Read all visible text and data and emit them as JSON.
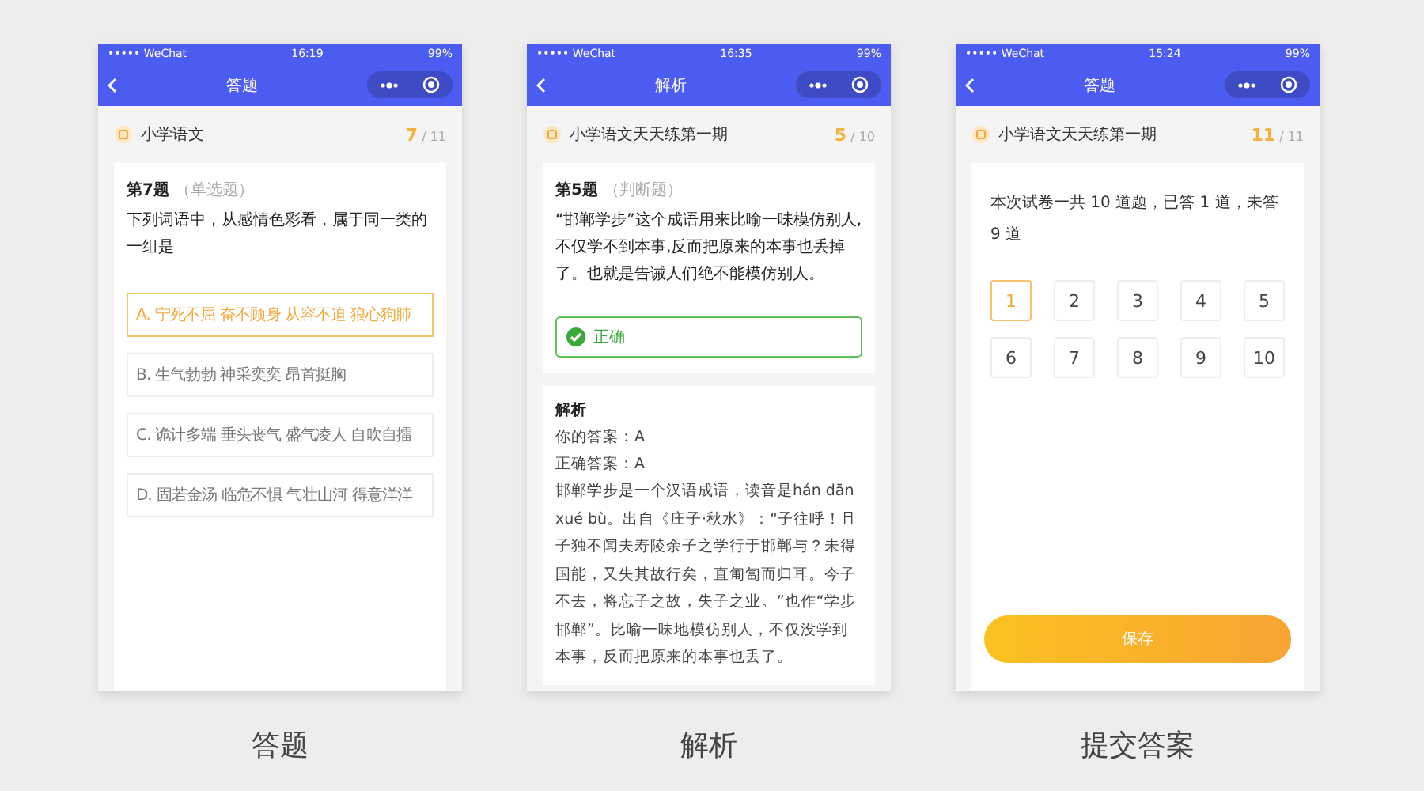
{
  "phones": [
    {
      "kind": "question",
      "status": {
        "carrier": "••••• WeChat",
        "time": "16:19",
        "battery": "99%"
      },
      "nav_title": "答题",
      "subject": "小学语文",
      "progress_current": "7",
      "progress_total": "/ 11",
      "question_number": "第7题",
      "question_type": "（单选题）",
      "question_text": "下列词语中，从感情色彩看，属于同一类的一组是",
      "options": [
        {
          "text": "A. 宁死不屈 奋不顾身 从容不迫 狼心狗肺",
          "selected": true
        },
        {
          "text": "B. 生气勃勃 神采奕奕 昂首挺胸",
          "selected": false
        },
        {
          "text": "C. 诡计多端 垂头丧气 盛气凌人 自吹自擂",
          "selected": false
        },
        {
          "text": "D. 固若金汤 临危不惧 气壮山河 得意洋洋",
          "selected": false
        }
      ],
      "caption": "答题"
    },
    {
      "kind": "analysis",
      "status": {
        "carrier": "••••• WeChat",
        "time": "16:35",
        "battery": "99%"
      },
      "nav_title": "解析",
      "subject": "小学语文天天练第一期",
      "progress_current": "5",
      "progress_total": "/ 10",
      "question_number": "第5题",
      "question_type": "（判断题）",
      "question_text": "“邯郸学步”这个成语用来比喻一味模仿别人,不仅学不到本事,反而把原来的本事也丢掉了。也就是告诫人们绝不能模仿别人。",
      "result": {
        "label": "正确",
        "correct": true
      },
      "explanation_title": "解析",
      "your_answer": "你的答案：A",
      "correct_answer": "正确答案：A",
      "explanation": "邯郸学步是一个汉语成语，读音是hán dān xué bù。出自《庄子·秋水》：“子往呼！且子独不闻夫寿陵余子之学行于邯郸与？未得国能，又失其故行矣，直匍匐而归耳。今子不去，将忘子之故，失子之业。”也作“学步邯郸”。比喻一味地模仿别人，不仅没学到本事，反而把原来的本事也丢了。",
      "caption": "解析"
    },
    {
      "kind": "submit",
      "status": {
        "carrier": "••••• WeChat",
        "time": "15:24",
        "battery": "99%"
      },
      "nav_title": "答题",
      "subject": "小学语文天天练第一期",
      "progress_current": "11",
      "progress_total": "/ 11",
      "summary": "本次试卷一共 10 道题，已答 1 道，未答 9 道",
      "numbers": [
        {
          "label": "1",
          "selected": true
        },
        {
          "label": "2",
          "selected": false
        },
        {
          "label": "3",
          "selected": false
        },
        {
          "label": "4",
          "selected": false
        },
        {
          "label": "5",
          "selected": false
        },
        {
          "label": "6",
          "selected": false
        },
        {
          "label": "7",
          "selected": false
        },
        {
          "label": "8",
          "selected": false
        },
        {
          "label": "9",
          "selected": false
        },
        {
          "label": "10",
          "selected": false
        }
      ],
      "save_button": "保存",
      "caption": "提交答案"
    }
  ]
}
